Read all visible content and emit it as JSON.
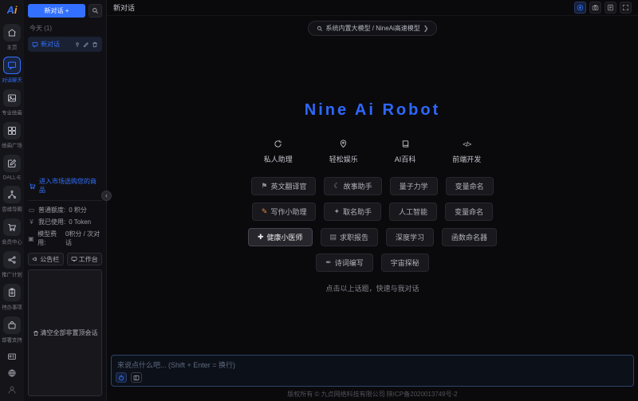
{
  "app": {
    "logo": "Ai",
    "footer": "版权所有 © 九点网络科技有限公司 陕ICP备2020013749号-2"
  },
  "colors": {
    "accent": "#3370ff",
    "logo_orange": "#f5a020",
    "pen_orange": "#e08a3c"
  },
  "sidebar": {
    "items": [
      {
        "label": "主页"
      },
      {
        "label": "对话聊天"
      },
      {
        "label": "专业绘画"
      },
      {
        "label": "绘画广场"
      },
      {
        "label": "DALL-E"
      },
      {
        "label": "思维导图"
      },
      {
        "label": "会员中心"
      },
      {
        "label": "推广计划"
      },
      {
        "label": "待办事项"
      },
      {
        "label": "部署支持"
      }
    ]
  },
  "chat_panel": {
    "new_chat_label": "新对话 +",
    "group_label": "今天 (1)",
    "chat_item": {
      "title": "新对话"
    },
    "market_link": "进入市场选购您的商品",
    "stats": [
      {
        "label": "普通额度:",
        "value": "0 积分"
      },
      {
        "label": "我已使用:",
        "value": "0 Token"
      },
      {
        "label": "模型费用:",
        "value": "0积分 / 次对话"
      }
    ],
    "announcement_label": "公告栏",
    "workbench_label": "工作台",
    "clear_label": "清空全部非置顶会话"
  },
  "main": {
    "title": "新对话",
    "model_pill": "系统内置大模型 / NineAi高速模型",
    "hero_title": "Nine Ai Robot",
    "categories": [
      {
        "label": "私人助理"
      },
      {
        "label": "轻松娱乐"
      },
      {
        "label": "AI百科"
      },
      {
        "label": "前端开发"
      }
    ],
    "topics": [
      [
        {
          "label": "英文翻译官"
        },
        {
          "label": "故事助手"
        },
        {
          "label": "量子力学"
        },
        {
          "label": "变量命名"
        }
      ],
      [
        {
          "label": "写作小助理"
        },
        {
          "label": "取名助手"
        },
        {
          "label": "人工智能"
        },
        {
          "label": "变量命名"
        }
      ],
      [
        {
          "label": "健康小医师"
        },
        {
          "label": "求职报告"
        },
        {
          "label": "深度学习"
        },
        {
          "label": "函数命名器"
        }
      ],
      [
        {
          "label": "诗词编写"
        },
        {
          "label": "宇宙探秘"
        }
      ]
    ],
    "hint": "点击以上话题，快速与我对话",
    "input_placeholder": "来说点什么吧... (Shift + Enter = 换行)"
  }
}
